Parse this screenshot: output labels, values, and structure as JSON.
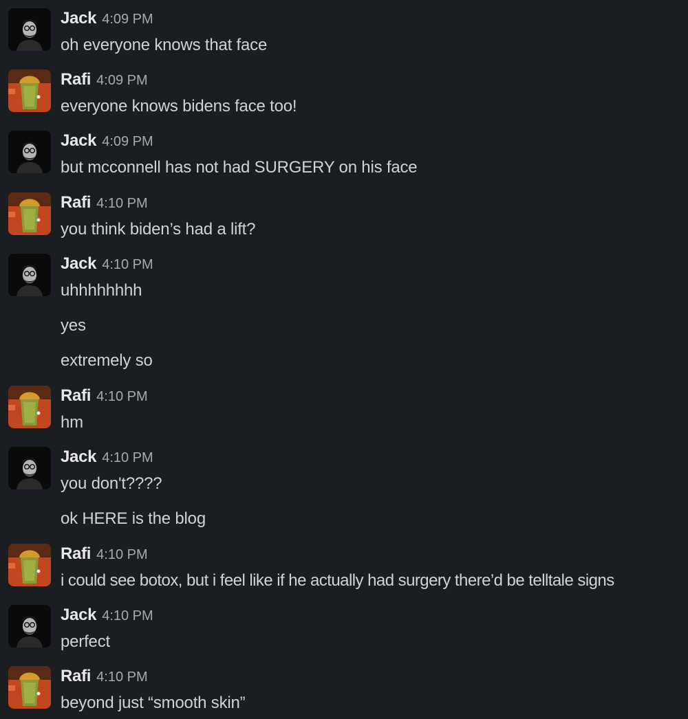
{
  "messages": [
    {
      "author": "Jack",
      "avatar": "jack-avatar",
      "time": "4:09 PM",
      "lines": [
        "oh everyone knows that face"
      ]
    },
    {
      "author": "Rafi",
      "avatar": "rafi-avatar",
      "time": "4:09 PM",
      "lines": [
        "everyone knows bidens face too!"
      ]
    },
    {
      "author": "Jack",
      "avatar": "jack-avatar",
      "time": "4:09 PM",
      "lines": [
        "but mcconnell has not had SURGERY on his face"
      ]
    },
    {
      "author": "Rafi",
      "avatar": "rafi-avatar",
      "time": "4:10 PM",
      "lines": [
        "you think biden’s had a lift?"
      ]
    },
    {
      "author": "Jack",
      "avatar": "jack-avatar",
      "time": "4:10 PM",
      "lines": [
        "uhhhhhhhh",
        "yes",
        "extremely so"
      ]
    },
    {
      "author": "Rafi",
      "avatar": "rafi-avatar",
      "time": "4:10 PM",
      "lines": [
        "hm"
      ]
    },
    {
      "author": "Jack",
      "avatar": "jack-avatar",
      "time": "4:10 PM",
      "lines": [
        "you don't????",
        "ok HERE is the blog"
      ]
    },
    {
      "author": "Rafi",
      "avatar": "rafi-avatar",
      "time": "4:10 PM",
      "lines": [
        "i could see botox, but i feel like if he actually had surgery there’d be telltale signs"
      ]
    },
    {
      "author": "Jack",
      "avatar": "jack-avatar",
      "time": "4:10 PM",
      "lines": [
        "perfect"
      ]
    },
    {
      "author": "Rafi",
      "avatar": "rafi-avatar",
      "time": "4:10 PM",
      "lines": [
        "beyond just “smooth skin”"
      ]
    }
  ]
}
